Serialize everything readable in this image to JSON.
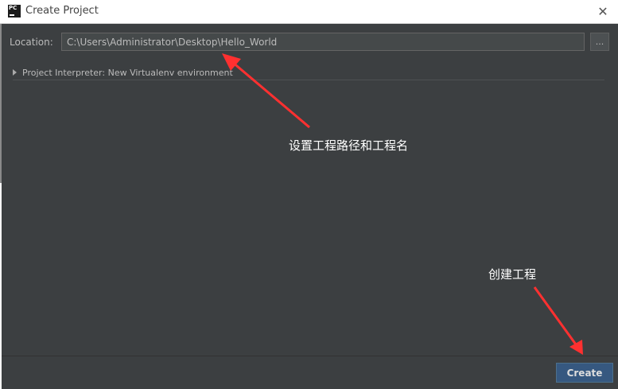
{
  "window": {
    "title": "Create Project",
    "logo_text": "PC",
    "close_glyph": "✕"
  },
  "form": {
    "location_label": "Location:",
    "location_value": "C:\\Users\\Administrator\\Desktop\\Hello_World",
    "browse_label": "...",
    "interpreter_label": "Project Interpreter: New Virtualenv environment"
  },
  "annotations": {
    "path_note": "设置工程路径和工程名",
    "create_note": "创建工程"
  },
  "footer": {
    "create_label": "Create"
  },
  "colors": {
    "dialog_bg": "#3c3f41",
    "accent_button": "#365880",
    "annotation_arrow": "#ff3030"
  },
  "icons": {
    "logo": "pycharm-logo-icon",
    "close": "close-icon",
    "expand": "triangle-right-icon",
    "arrow": "red-arrow-icon"
  }
}
